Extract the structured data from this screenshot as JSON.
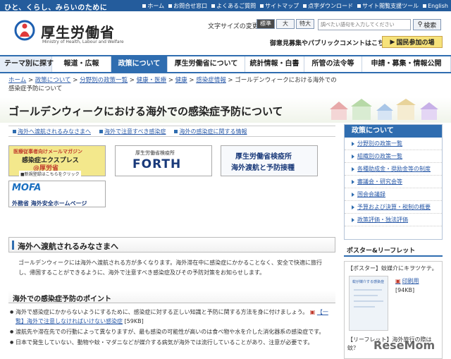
{
  "topbar": {
    "tagline": "ひと、くらし、みらいのために",
    "links": [
      "ホーム",
      "お問合せ窓口",
      "よくあるご質問",
      "サイトマップ",
      "点字ダウンロード",
      "サイト閲覧支援ツール",
      "English"
    ]
  },
  "header": {
    "logo_text": "厚生労働省",
    "logo_sub": "Ministry of Health, Labour and Welfare",
    "fontsize_label": "文字サイズの変更",
    "fontsize_options": [
      "標準",
      "大",
      "特大"
    ],
    "search_placeholder": "調べたい語句を入力してください",
    "search_button": "検索",
    "opinion_link": "御意見募集やパブリックコメントはこちら",
    "join_button": "国民参加の場"
  },
  "gnav": {
    "items": [
      "テーマ別に探す",
      "報道・広報",
      "政策について",
      "厚生労働省について",
      "統計情報・白書",
      "所管の法令等",
      "申請・募集・情報公開"
    ]
  },
  "breadcrumb": {
    "items": [
      "ホーム",
      "政策について",
      "分野別の政策一覧",
      "健康・医療",
      "健康",
      "感染症情報"
    ],
    "current": "ゴールデンウィークにおける海外での感染症予防について"
  },
  "page": {
    "title": "ゴールデンウィークにおける海外での感染症予防について"
  },
  "anchors": [
    "海外へ渡航されるみなさまへ",
    "海外で注意すべき感染症",
    "海外の感染症に関する情報"
  ],
  "banners": {
    "b1": {
      "line1": "医療従事者向けメールマガジン",
      "line2": "感染症エクスプレス",
      "line3": "@厚労省",
      "line4": "■新規登録はこちらをクリック"
    },
    "b2": {
      "line1": "厚生労働省検疫所",
      "line2": "FORTH"
    },
    "b3": {
      "line1": "厚生労働省検疫所",
      "line2": "海外渡航と予防接種"
    },
    "b4": {
      "line1": "MOFA",
      "line2": "外務省 海外安全ホームページ"
    }
  },
  "section": {
    "heading": "海外へ渡航されるみなさまへ",
    "paragraph": "ゴールデンウィークには海外へ渡航される方が多くなります。海外滞在中に感染症にかかることなく、安全で快適に旅行し、帰国することができるように、海外で注意すべき感染症及びその予防対策をお知らせします。",
    "subheading": "海外での感染症予防のポイント",
    "bullets": [
      {
        "text": "海外で感染症にかからないようにするために、感染症に対する正しい知識と予防に関する方法を身に付けましょう。",
        "link": "【一覧】海外で注意しなければいけない感染症",
        "size": "[59KB]"
      },
      {
        "text": "渡航先や滞在先での行動によって異なりますが、最も感染の可能性が高いのは食べ物や水を介した消化器系の感染症です。",
        "link": "",
        "size": ""
      },
      {
        "text": "日本で発生していない、動物や蚊・マダニなどが媒介する病気が海外では流行していることがあり、注意が必要です。",
        "link": "",
        "size": ""
      }
    ]
  },
  "sidebar": {
    "heading": "政策について",
    "items": [
      "分野別の政策一覧",
      "組織別の政策一覧",
      "各種助成金・奨励金等の制度",
      "審議会・研究会等",
      "国会会議録",
      "予算および決算・税制の概要",
      "政策評価・独法評価"
    ]
  },
  "poster": {
    "heading": "ポスター&リーフレット",
    "title": "【ポスター】蚊媒介にキヲツケテ。",
    "thumb_label": "蚊が媒介する感染症",
    "pdf_label": "印刷用",
    "pdf_size": "[94KB]",
    "leaflet": "【リーフレット】海外旅行の際は 蚊？"
  },
  "watermark": "ReseMom",
  "colors": {
    "accent": "#2f6db0",
    "topbar": "#245c9c",
    "link": "#2a5aa8"
  }
}
